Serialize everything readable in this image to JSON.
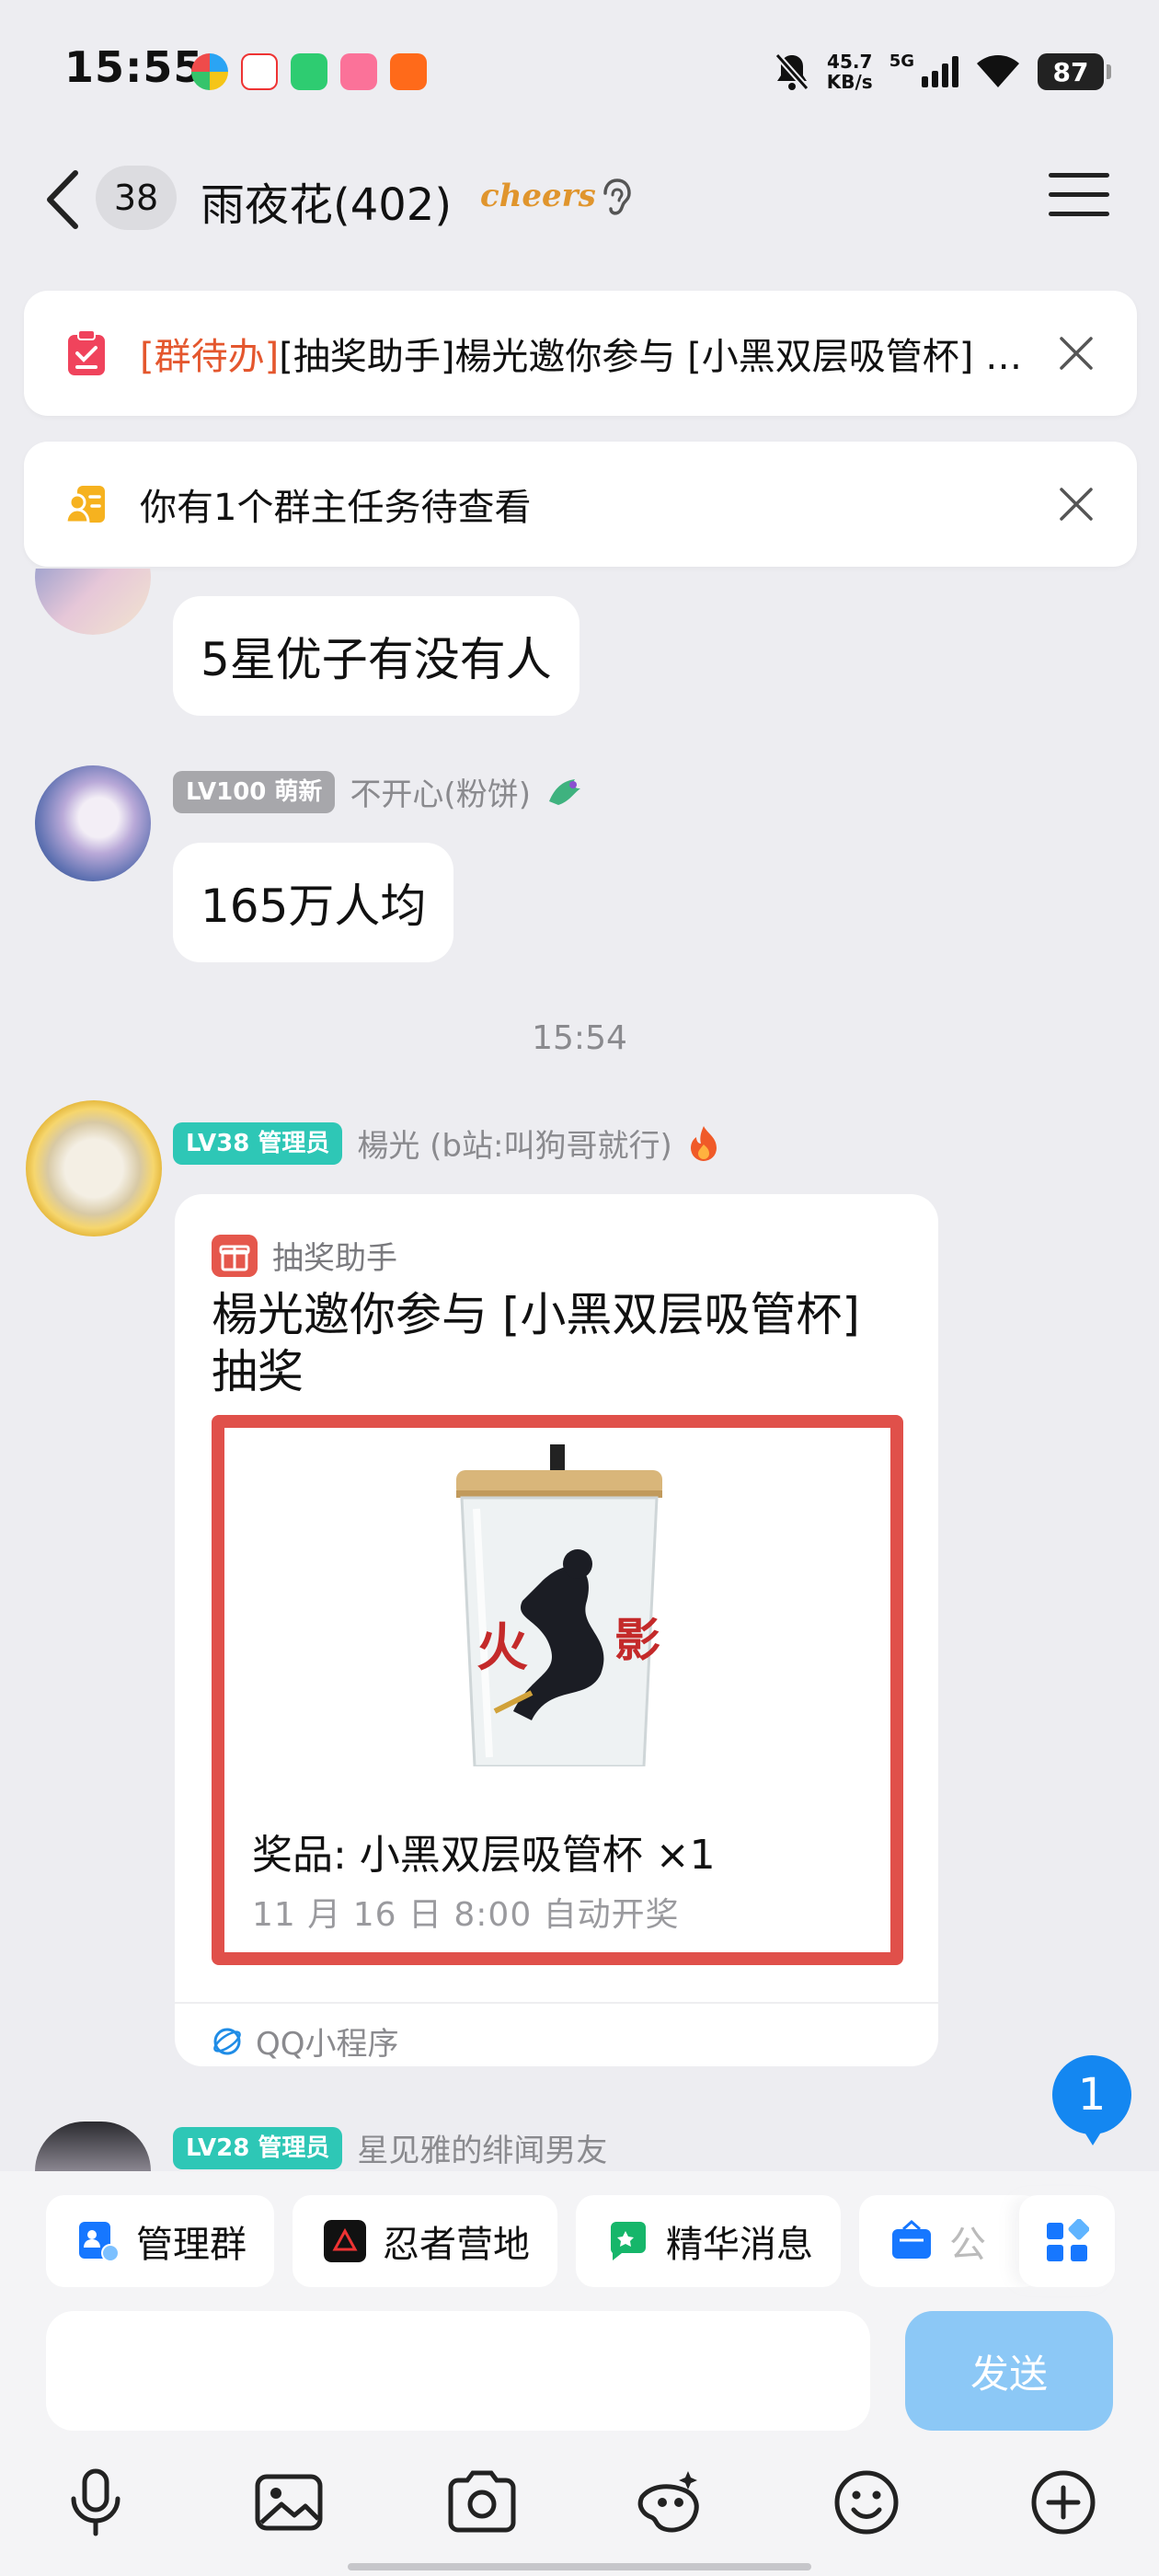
{
  "status_bar": {
    "time": "15:55",
    "net_speed_value": "45.7",
    "net_speed_unit": "KB/s",
    "network": "5G",
    "battery": "87"
  },
  "header": {
    "unread_count": "38",
    "title": "雨夜花(402)",
    "badge_logo": "cheers"
  },
  "notices": [
    {
      "tag": "[群待办]",
      "text": "[抽奖助手]楊光邀你参与 [小黑双层吸管杯] 抽奖",
      "icon": "todo-clipboard-icon"
    },
    {
      "text": "你有1个群主任务待查看",
      "icon": "owner-task-icon"
    }
  ],
  "messages": {
    "partial_bubble": "5星优子有没有人",
    "msg1": {
      "level": "LV100 萌新",
      "sender": "不开心(粉饼)",
      "text": "165万人均"
    },
    "timestamp": "15:54",
    "msg2": {
      "level": "LV38 管理员",
      "sender": "楊光 (b站:叫狗哥就行)",
      "card": {
        "source": "抽奖助手",
        "title": "楊光邀你参与 [小黑双层吸管杯] 抽奖",
        "prize": "奖品: 小黑双层吸管杯 ×1",
        "draw_time": "11 月 16 日 8:00 自动开奖",
        "footer": "QQ小程序"
      }
    },
    "msg3": {
      "level": "LV28 管理员",
      "sender": "星见雅的绯闻男友"
    }
  },
  "new_message_badge": "1",
  "quick_actions": [
    {
      "label": "管理群",
      "icon": "manage-group-icon",
      "color": "#1677ff"
    },
    {
      "label": "忍者营地",
      "icon": "ninja-camp-icon",
      "color": "#111111"
    },
    {
      "label": "精华消息",
      "icon": "featured-message-icon",
      "color": "#16b66a"
    },
    {
      "label": "公",
      "icon": "announcement-icon",
      "color": "#1677ff"
    }
  ],
  "input": {
    "placeholder": ""
  },
  "send_label": "发送",
  "toolbar": [
    "microphone-icon",
    "image-icon",
    "camera-icon",
    "stickers-icon",
    "emoji-icon",
    "plus-icon"
  ],
  "colors": {
    "accent": "#1487f1",
    "lottery_border": "#e0504a",
    "notice_tag": "#e4572e",
    "teal_badge": "#2ec7b6"
  }
}
